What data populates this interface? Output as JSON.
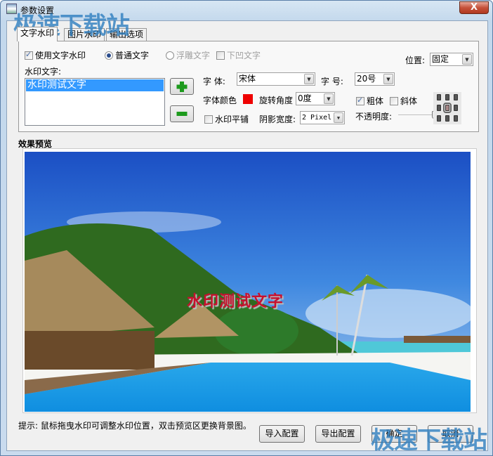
{
  "window": {
    "title": "参数设置",
    "close": "X"
  },
  "tabs": [
    {
      "label": "文字水印",
      "active": true
    },
    {
      "label": "图片水印"
    },
    {
      "label": "输出选项"
    }
  ],
  "text_wm": {
    "use_text_watermark": {
      "label": "使用文字水印",
      "checked": true
    },
    "mode_normal": {
      "label": "普通文字",
      "selected": true
    },
    "mode_emboss": {
      "label": "浮雕文字",
      "selected": false,
      "disabled": true
    },
    "mode_sunken": {
      "label": "下凹文字",
      "checked": false,
      "disabled": true
    },
    "position_label": "位置:",
    "position_value": "固定",
    "list_label": "水印文字:",
    "list_items": [
      "水印测试文字"
    ],
    "font_label": "字  体:",
    "font_value": "宋体",
    "size_label": "字  号:",
    "size_value": "20号",
    "color_label": "字体颜色",
    "font_color": "#ee0000",
    "rotate_label": "旋转角度",
    "rotate_value": "0度",
    "bold": {
      "label": "粗体",
      "checked": true
    },
    "italic": {
      "label": "斜体",
      "checked": false
    },
    "tile": {
      "label": "水印平铺",
      "checked": false
    },
    "shadow_label": "阴影宽度:",
    "shadow_value": "2 Pixel",
    "opacity_label": "不透明度:",
    "opacity_percent": 85,
    "alignment_selected": "center"
  },
  "preview": {
    "label": "效果预览",
    "watermark_text": "水印测试文字",
    "watermark_color": "#c8102e"
  },
  "hint": "提示: 鼠标拖曳水印可调整水印位置，双击预览区更换背景图。",
  "buttons": {
    "import": "导入配置",
    "export": "导出配置",
    "ok": "确定",
    "cancel": "取消"
  },
  "site_watermark": "极速下载站"
}
